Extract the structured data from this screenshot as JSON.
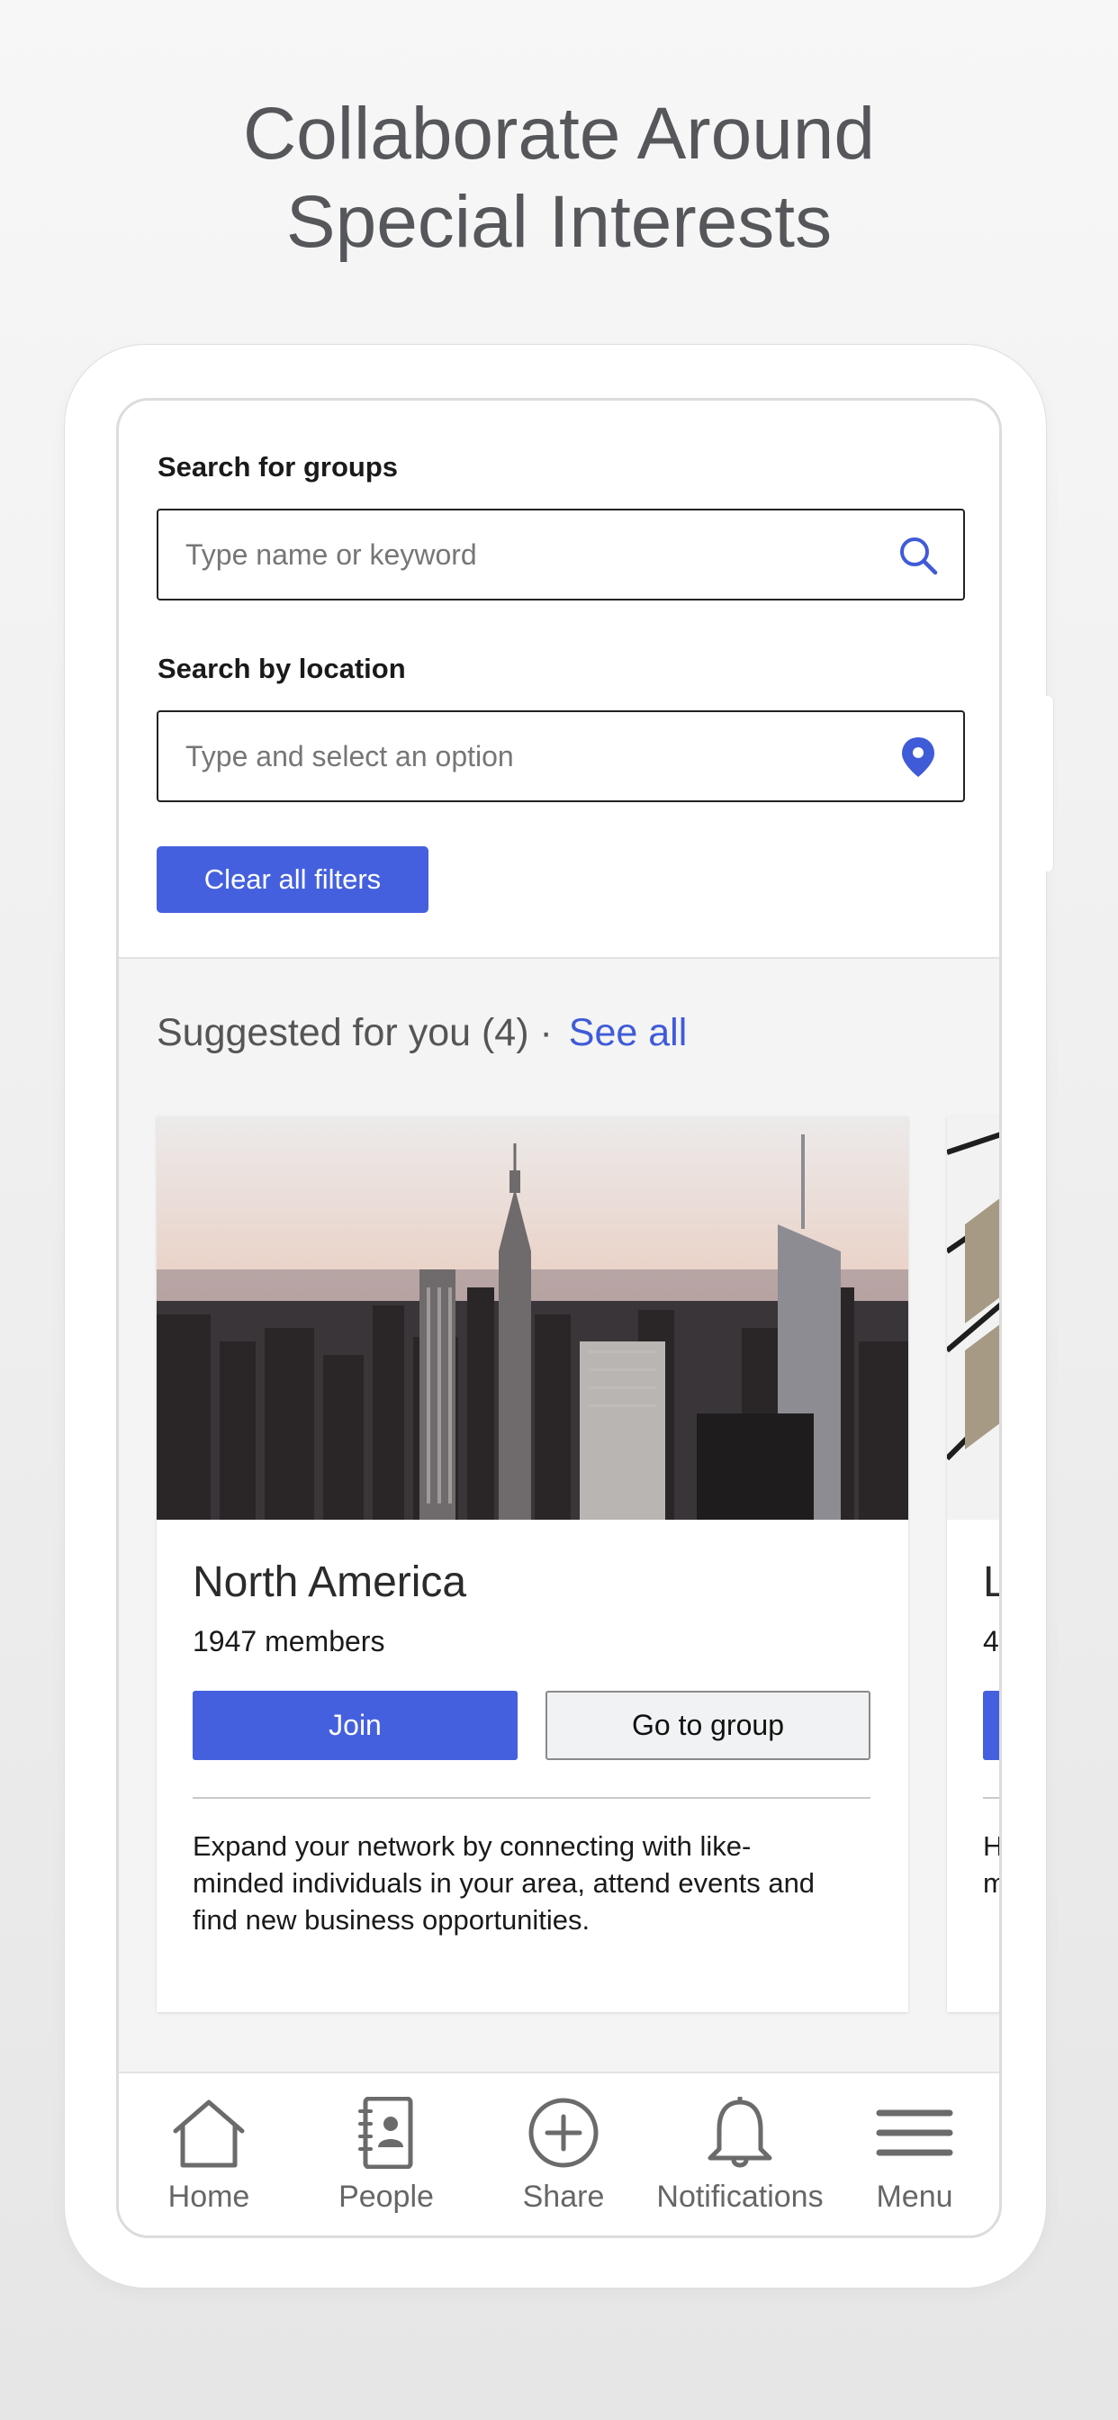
{
  "headline": {
    "line1": "Collaborate Around",
    "line2": "Special Interests"
  },
  "filters": {
    "group_search_label": "Search for groups",
    "group_search_placeholder": "Type name or keyword",
    "location_label": "Search by location",
    "location_placeholder": "Type and select an option",
    "clear_label": "Clear all filters"
  },
  "suggested": {
    "heading": "Suggested for you (4) ·",
    "see_all": "See all"
  },
  "cards": [
    {
      "title": "North America",
      "members": "1947 members",
      "join_label": "Join",
      "goto_label": "Go to group",
      "description": "Expand your network by connecting with like-minded individuals in your area, attend events and find new business opportunities."
    },
    {
      "title": "L",
      "members": "4",
      "join_label": "",
      "goto_label": "",
      "description": "H m"
    }
  ],
  "tabbar": {
    "items": [
      {
        "label": "Home",
        "icon": "home-icon"
      },
      {
        "label": "People",
        "icon": "contacts-icon"
      },
      {
        "label": "Share",
        "icon": "plus-circle-icon"
      },
      {
        "label": "Notifications",
        "icon": "bell-icon"
      },
      {
        "label": "Menu",
        "icon": "hamburger-icon"
      }
    ]
  },
  "colors": {
    "accent": "#4560de",
    "link": "#3f5bd8",
    "headline": "#55575a",
    "tab_icon": "#6b6b6b"
  }
}
